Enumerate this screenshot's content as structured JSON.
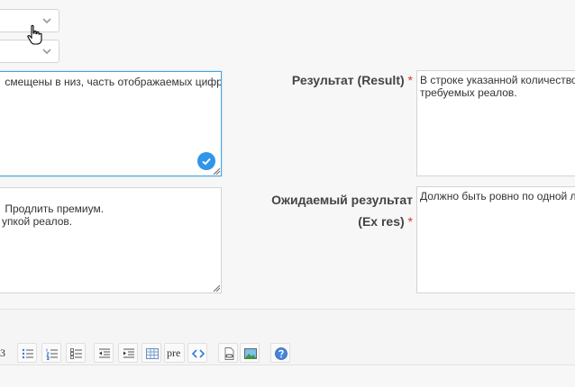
{
  "form": {
    "description_value": " смещены в низ, часть отображаемых цифр",
    "steps_value": " Продлить премиум.\nупкой реалов.",
    "result_label": "Результат (Result)",
    "result_required": "*",
    "result_value": "В строке указанной количество\nтребуемых реалов.",
    "expected_label_line1": "Ожидаемый результат",
    "expected_label_line2": "(Ex res)",
    "expected_required": "*",
    "expected_value": "Должно быть ровно по одной л"
  },
  "toolbar": {
    "heading_fragment": "3",
    "pre_label": "pre"
  },
  "icons": [
    "chevron-down-icon",
    "checkmark-icon",
    "resize-handle-icon",
    "hand-pointer-icon",
    "bullet-list-icon",
    "numbered-list-icon",
    "checklist-icon",
    "outdent-icon",
    "indent-icon",
    "table-icon",
    "code-icon",
    "link-icon",
    "image-icon",
    "help-icon"
  ],
  "colors": {
    "accent": "#2f96e8",
    "focus_border": "#4aa3d8",
    "required": "#d9342b",
    "background": "#f7f7f7"
  }
}
